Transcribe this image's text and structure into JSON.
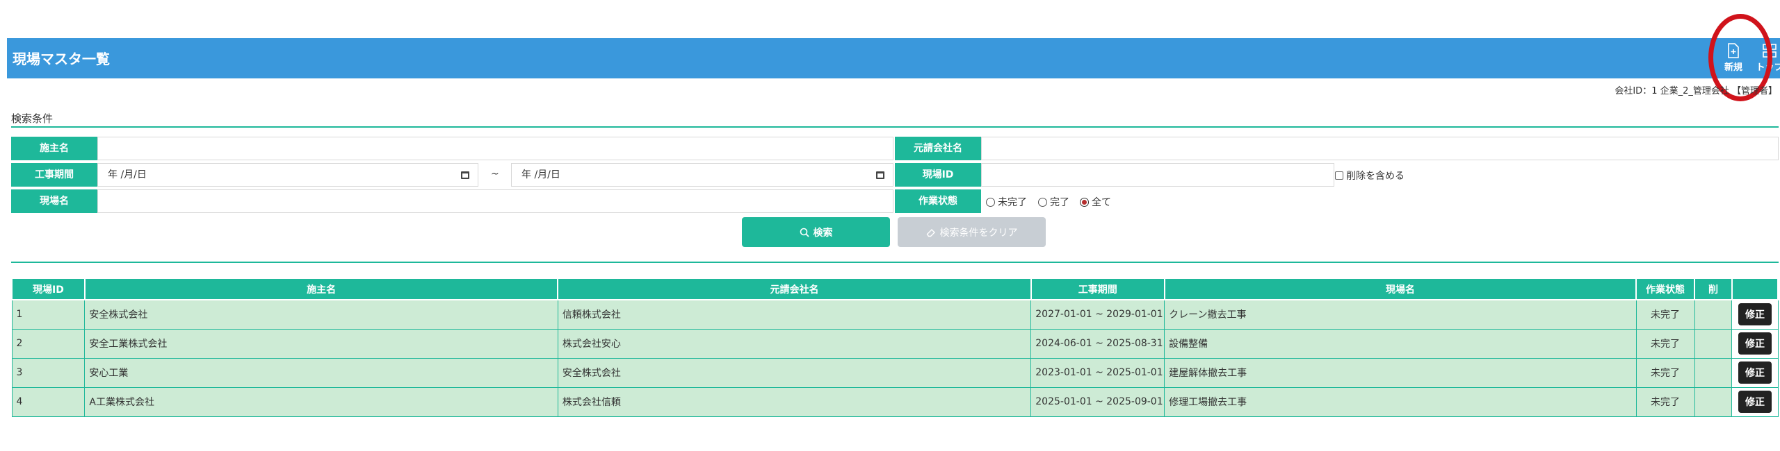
{
  "header": {
    "title": "現場マスタ一覧",
    "new_label": "新規",
    "top_label": "トップ",
    "color": "#3a98dc"
  },
  "company_info": "会社ID：1 企業_2_管理会社 【管理者】",
  "search": {
    "section_title": "検索条件",
    "owner_label": "施主名",
    "owner_value": "",
    "prime_label": "元請会社名",
    "prime_value": "",
    "period_label": "工事期間",
    "date_from_placeholder": "年 /月/日",
    "date_to_placeholder": "年 /月/日",
    "tilde": "~",
    "site_id_label": "現場ID",
    "site_id_value": "",
    "include_deleted_label": "削除を含める",
    "site_name_label": "現場名",
    "site_name_value": "",
    "status_label": "作業状態",
    "status_options": [
      "未完了",
      "完了",
      "全て"
    ],
    "status_selected": "全て",
    "search_button": "検索",
    "clear_button": "検索条件をクリア"
  },
  "table": {
    "headers": [
      "現場ID",
      "施主名",
      "元請会社名",
      "工事期間",
      "現場名",
      "作業状態",
      "削",
      ""
    ],
    "edit_label": "修正",
    "rows": [
      {
        "id": "1",
        "owner": "安全株式会社",
        "prime": "信頼株式会社",
        "period": "2027-01-01 ~ 2029-01-01",
        "site": "クレーン撤去工事",
        "status": "未完了",
        "deleted": ""
      },
      {
        "id": "2",
        "owner": "安全工業株式会社",
        "prime": "株式会社安心",
        "period": "2024-06-01 ~ 2025-08-31",
        "site": "設備整備",
        "status": "未完了",
        "deleted": ""
      },
      {
        "id": "3",
        "owner": "安心工業",
        "prime": "安全株式会社",
        "period": "2023-01-01 ~ 2025-01-01",
        "site": "建屋解体撤去工事",
        "status": "未完了",
        "deleted": ""
      },
      {
        "id": "4",
        "owner": "A工業株式会社",
        "prime": "株式会社信頼",
        "period": "2025-01-01 ~ 2025-09-01",
        "site": "修理工場撤去工事",
        "status": "未完了",
        "deleted": ""
      }
    ]
  },
  "colors": {
    "accent": "#1eb89a",
    "row_bg": "#cdebd5",
    "annotation_circle": "#d0131b"
  }
}
